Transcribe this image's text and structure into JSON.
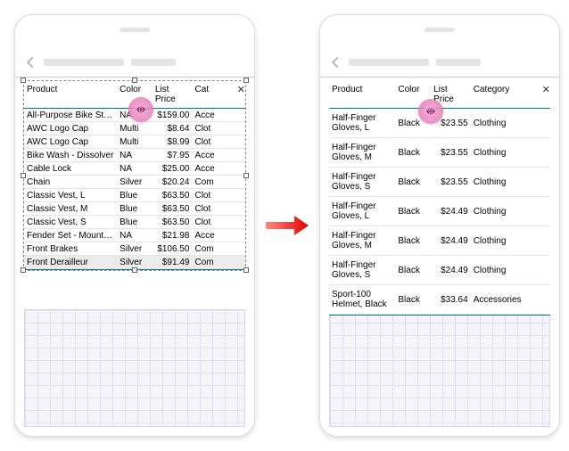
{
  "columns": {
    "product": "Product",
    "color": "Color",
    "price": "List Price",
    "category": "Category",
    "category_short": "Cat"
  },
  "drag_icon": "resize-horizontal-icon",
  "left_panel": {
    "selected_row_index": 11,
    "rows": [
      {
        "product": "All-Purpose Bike Stand",
        "color": "NA",
        "price": "$159.00",
        "category": "Acce"
      },
      {
        "product": "AWC Logo Cap",
        "color": "Multi",
        "price": "$8.64",
        "category": "Clot"
      },
      {
        "product": "AWC Logo Cap",
        "color": "Multi",
        "price": "$8.99",
        "category": "Clot"
      },
      {
        "product": "Bike Wash - Dissolver",
        "color": "NA",
        "price": "$7.95",
        "category": "Acce"
      },
      {
        "product": "Cable Lock",
        "color": "NA",
        "price": "$25.00",
        "category": "Acce"
      },
      {
        "product": "Chain",
        "color": "Silver",
        "price": "$20.24",
        "category": "Com"
      },
      {
        "product": "Classic Vest, L",
        "color": "Blue",
        "price": "$63.50",
        "category": "Clot"
      },
      {
        "product": "Classic Vest, M",
        "color": "Blue",
        "price": "$63.50",
        "category": "Clot"
      },
      {
        "product": "Classic Vest, S",
        "color": "Blue",
        "price": "$63.50",
        "category": "Clot"
      },
      {
        "product": "Fender Set - Mountain",
        "color": "NA",
        "price": "$21.98",
        "category": "Acce"
      },
      {
        "product": "Front Brakes",
        "color": "Silver",
        "price": "$106.50",
        "category": "Com"
      },
      {
        "product": "Front Derailleur",
        "color": "Silver",
        "price": "$91.49",
        "category": "Com"
      }
    ]
  },
  "right_panel": {
    "rows": [
      {
        "product": "Half-Finger Gloves, L",
        "color": "Black",
        "price": "$23.55",
        "category": "Clothing"
      },
      {
        "product": "Half-Finger Gloves, M",
        "color": "Black",
        "price": "$23.55",
        "category": "Clothing"
      },
      {
        "product": "Half-Finger Gloves, S",
        "color": "Black",
        "price": "$23.55",
        "category": "Clothing"
      },
      {
        "product": "Half-Finger Gloves, L",
        "color": "Black",
        "price": "$24.49",
        "category": "Clothing"
      },
      {
        "product": "Half-Finger Gloves, M",
        "color": "Black",
        "price": "$24.49",
        "category": "Clothing"
      },
      {
        "product": "Half-Finger Gloves, S",
        "color": "Black",
        "price": "$24.49",
        "category": "Clothing"
      },
      {
        "product": "Sport-100 Helmet, Black",
        "color": "Black",
        "price": "$33.64",
        "category": "Accessories"
      }
    ]
  }
}
